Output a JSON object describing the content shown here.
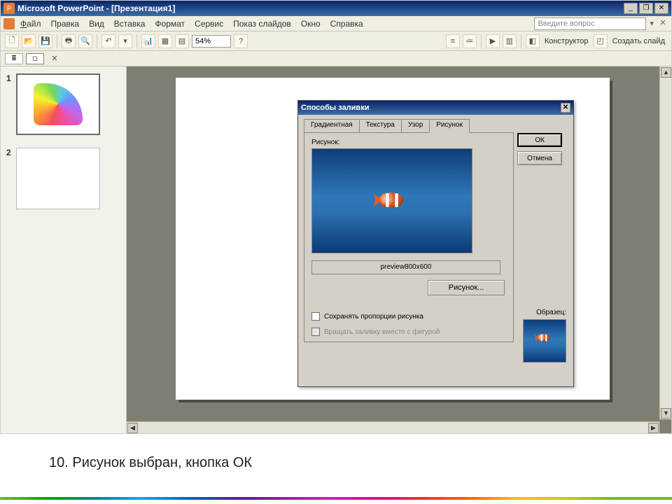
{
  "titlebar": {
    "app_name": "Microsoft PowerPoint - [Презентация1]"
  },
  "window_controls": {
    "min": "_",
    "restore": "❐",
    "close": "✕"
  },
  "menu": {
    "file": "Файл",
    "edit": "Правка",
    "view": "Вид",
    "insert": "Вставка",
    "format": "Формат",
    "tools": "Сервис",
    "slideshow": "Показ слайдов",
    "window": "Окно",
    "help": "Справка",
    "type_question": "Введите вопрос"
  },
  "toolbar": {
    "zoom": "54%",
    "designer": "Конструктор",
    "new_slide": "Создать слайд"
  },
  "thumbnails": {
    "slide1_num": "1",
    "slide2_num": "2"
  },
  "dialog": {
    "title": "Способы заливки",
    "tabs": {
      "gradient": "Градиентная",
      "texture": "Текстура",
      "pattern": "Узор",
      "picture": "Рисунок"
    },
    "picture_label": "Рисунок:",
    "filename": "preview800x600",
    "select_picture_btn": "Рисунок...",
    "lock_aspect": "Сохранять пропорции рисунка",
    "rotate_fill": "Вращать заливку вместе с фигурой",
    "sample_label": "Образец:",
    "ok": "ОК",
    "cancel": "Отмена"
  },
  "caption": "10.   Рисунок выбран, кнопка ОК"
}
